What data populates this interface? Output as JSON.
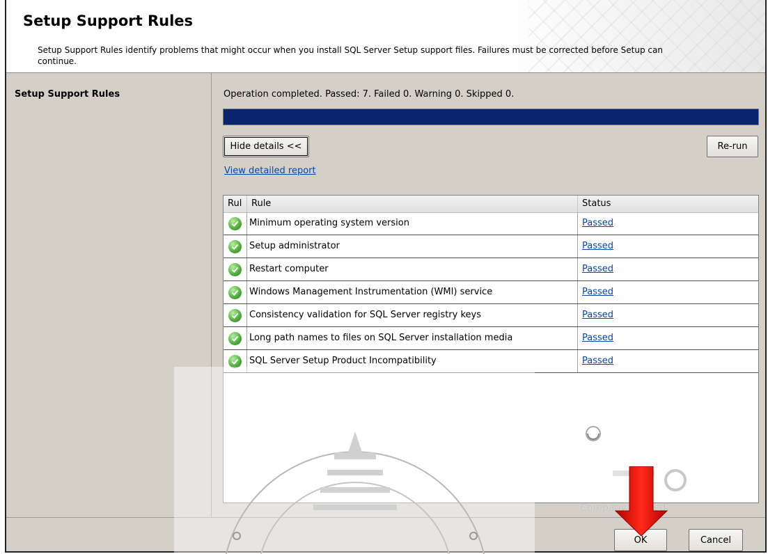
{
  "header": {
    "title": "Setup Support Rules",
    "subtitle": "Setup Support Rules identify problems that might occur when you install SQL Server Setup support files. Failures must be corrected before Setup can continue."
  },
  "nav": {
    "items": [
      {
        "label": "Setup Support Rules"
      }
    ]
  },
  "main": {
    "operation_status": "Operation completed. Passed: 7.   Failed 0.   Warning 0.   Skipped 0.",
    "progress": 1.0,
    "hide_details_label": "Hide details <<",
    "rerun_label": "Re-run",
    "report_link": "View detailed report",
    "table": {
      "columns": [
        "Rul",
        "Rule",
        "Status"
      ],
      "rows": [
        {
          "rule": "Minimum operating system version",
          "status": "Passed"
        },
        {
          "rule": "Setup administrator",
          "status": "Passed"
        },
        {
          "rule": "Restart computer",
          "status": "Passed"
        },
        {
          "rule": "Windows Management Instrumentation (WMI) service",
          "status": "Passed"
        },
        {
          "rule": "Consistency validation for SQL Server registry keys",
          "status": "Passed"
        },
        {
          "rule": "Long path names to files on SQL Server installation media",
          "status": "Passed"
        },
        {
          "rule": "SQL Server Setup Product Incompatibility",
          "status": "Passed"
        }
      ]
    }
  },
  "footer": {
    "ok_label": "OK",
    "cancel_label": "Cancel"
  },
  "overlay": {
    "company_watermark": "Company Limited",
    "arrow_color": "#e01010"
  },
  "colors": {
    "progress_fill": "#0a2470",
    "link": "#0645ad",
    "pass": "#55b040"
  }
}
